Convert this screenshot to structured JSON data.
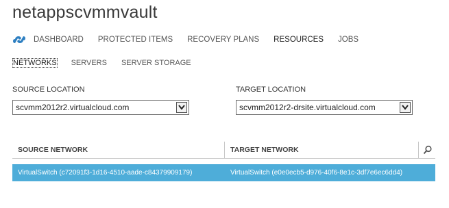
{
  "page": {
    "title": "netappscvmmvault"
  },
  "nav": {
    "logo_icon": "cloud-icon",
    "items": [
      "DASHBOARD",
      "PROTECTED ITEMS",
      "RECOVERY PLANS",
      "RESOURCES",
      "JOBS"
    ],
    "active": "RESOURCES"
  },
  "subnav": {
    "items": [
      "NETWORKS",
      "SERVERS",
      "SERVER STORAGE"
    ],
    "active": "NETWORKS"
  },
  "source": {
    "label": "SOURCE LOCATION",
    "value": "scvmm2012r2.virtualcloud.com"
  },
  "target": {
    "label": "TARGET LOCATION",
    "value": "scvmm2012r2-drsite.virtualcloud.com"
  },
  "table": {
    "headers": [
      "SOURCE NETWORK",
      "TARGET NETWORK"
    ],
    "search_icon": "search-icon",
    "rows": [
      {
        "source": "VirtualSwitch (c72091f3-1d16-4510-aade-c84379909179)",
        "target": "VirtualSwitch (e0e0ecb5-d976-40f6-8e1c-3df7e6ec6dd4)",
        "selected": true
      }
    ]
  },
  "colors": {
    "accent": "#4eadd9",
    "logo": "#2d7fc1"
  }
}
